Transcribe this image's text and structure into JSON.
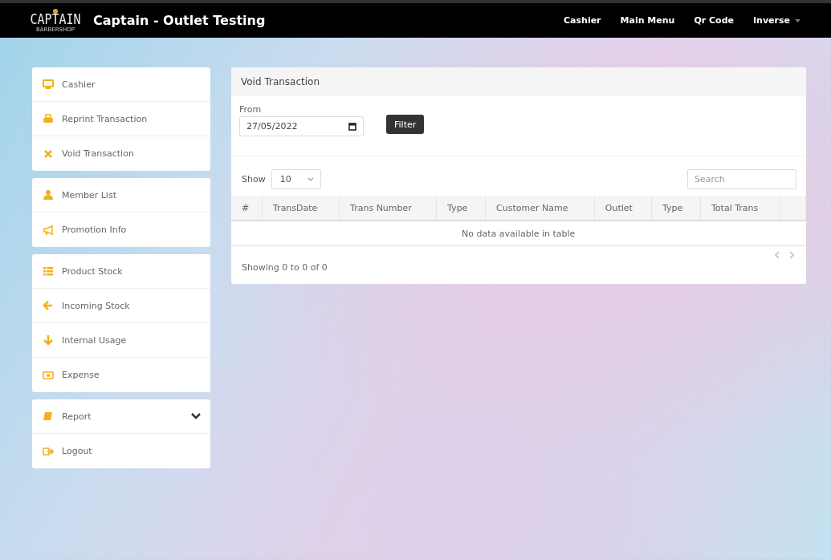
{
  "navbar": {
    "logo": {
      "title": "CAPTAIN",
      "subtitle": "BARBERSHOP"
    },
    "title": "Captain - Outlet Testing",
    "links": [
      {
        "label": "Cashier",
        "dropdown": false
      },
      {
        "label": "Main Menu",
        "dropdown": false
      },
      {
        "label": "Qr Code",
        "dropdown": false
      },
      {
        "label": "Inverse",
        "dropdown": true
      }
    ]
  },
  "sidebar": {
    "groups": [
      {
        "items": [
          {
            "label": "Cashier"
          },
          {
            "label": "Reprint Transaction"
          },
          {
            "label": "Void Transaction"
          }
        ]
      },
      {
        "items": [
          {
            "label": "Member List"
          },
          {
            "label": "Promotion Info"
          }
        ]
      },
      {
        "items": [
          {
            "label": "Product Stock"
          },
          {
            "label": "Incoming Stock"
          },
          {
            "label": "Internal Usage"
          },
          {
            "label": "Expense"
          }
        ]
      },
      {
        "items": [
          {
            "label": "Report",
            "expanded": false
          },
          {
            "label": "Logout"
          }
        ]
      }
    ]
  },
  "panel": {
    "title": "Void Transaction",
    "filter": {
      "label": "From",
      "value": "27/05/2022",
      "button": "Filter"
    },
    "length": {
      "label": "Show",
      "value": "10"
    },
    "search": {
      "placeholder": "Search"
    },
    "table": {
      "columns": [
        "#",
        "TransDate",
        "Trans Number",
        "Type",
        "Customer Name",
        "Outlet",
        "Type",
        "Total Trans",
        ""
      ],
      "empty": "No data available in table"
    },
    "info": "Showing 0 to 0 of 0"
  }
}
